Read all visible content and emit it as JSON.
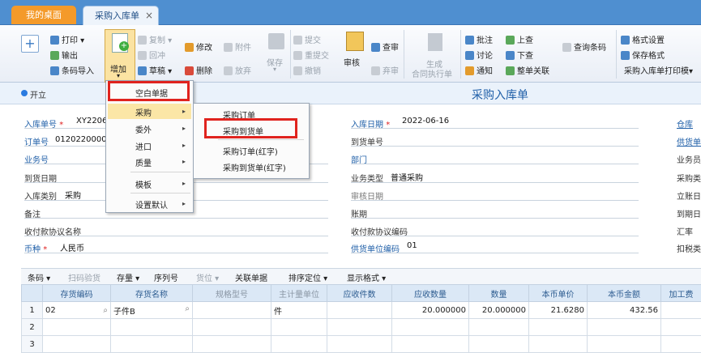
{
  "tabs": {
    "desktop": "我的桌面",
    "active": "采购入库单",
    "close": "×"
  },
  "ribbon": {
    "add": "增加",
    "print": "打印",
    "export": "输出",
    "barcode_import": "条码导入",
    "copy": "复制",
    "write_back": "回冲",
    "draft": "草稿",
    "modify": "修改",
    "delete": "删除",
    "attach": "附件",
    "abandon": "放弃",
    "save": "保存",
    "submit": "提交",
    "resubmit": "重提交",
    "withdraw": "撤销",
    "audit": "审核",
    "lookup": "查审",
    "discard": "弃审",
    "generate_1": "生成",
    "generate_2": "合同执行单",
    "annotate": "批注",
    "discuss": "讨论",
    "notify": "通知",
    "prev": "上查",
    "next": "下查",
    "whole_link": "整单关联",
    "query_barcode": "查询条码",
    "format_settings": "格式设置",
    "save_format": "保存格式",
    "print_template": "采购入库单打印模▾"
  },
  "status": {
    "open": "开立",
    "title": "采购入库单"
  },
  "form": {
    "inbound_no_label": "入库单号",
    "inbound_no": "XY22060",
    "order_no_label": "订单号",
    "order_no": "012022000001",
    "biz_no_label": "业务号",
    "arrival_date_label": "到货日期",
    "inbound_type_label": "入库类别",
    "inbound_type": "采购",
    "remark_label": "备注",
    "pay_agreement_label": "收付款协议名称",
    "currency_label": "币种",
    "currency": "人民币",
    "inbound_date_label": "入库日期",
    "inbound_date": "2022-06-16",
    "arrival_no_label": "到货单号",
    "dept_label": "部门",
    "biz_type_label": "业务类型",
    "biz_type": "普通采购",
    "audit_date_label": "审核日期",
    "account_period_label": "账期",
    "pay_agreement_code_label": "收付款协议编码",
    "supplier_code_label": "供货单位编码",
    "supplier_code": "01",
    "warehouse_label": "仓库",
    "supplier_label": "供货单",
    "biz_staff_label": "业务员",
    "purchase_type_label": "采购类",
    "account_date_label": "立账日",
    "due_date_label": "到期日",
    "rate_label": "汇率",
    "deduct_label": "扣税类"
  },
  "grid_toolbar": {
    "barcode": "条码",
    "scan_check": "扫码验货",
    "stock": "存量",
    "serial": "序列号",
    "location": "货位",
    "link_doc": "关联单据",
    "sort_pos": "排序定位",
    "display_fmt": "显示格式"
  },
  "grid": {
    "headers": [
      "",
      "存货编码",
      "存货名称",
      "规格型号",
      "主计量单位",
      "应收件数",
      "应收数量",
      "数量",
      "本币单价",
      "本币金额",
      "加工费"
    ],
    "rows": [
      {
        "n": "1",
        "code": "02",
        "name": "子件B",
        "spec": "",
        "unit": "件",
        "pieces": "",
        "due_qty": "20.000000",
        "qty": "20.000000",
        "price": "21.6280",
        "amount": "432.56",
        "fee": ""
      },
      {
        "n": "2",
        "code": "",
        "name": "",
        "spec": "",
        "unit": "",
        "pieces": "",
        "due_qty": "",
        "qty": "",
        "price": "",
        "amount": "",
        "fee": ""
      },
      {
        "n": "3",
        "code": "",
        "name": "",
        "spec": "",
        "unit": "",
        "pieces": "",
        "due_qty": "",
        "qty": "",
        "price": "",
        "amount": "",
        "fee": ""
      }
    ]
  },
  "menu1": {
    "blank": "空白单据",
    "purchase": "采购",
    "outsource": "委外",
    "import": "进口",
    "quality": "质量",
    "template": "模板",
    "default_settings": "设置默认"
  },
  "menu2": {
    "po": "采购订单",
    "arrival": "采购到货单",
    "po_red": "采购订单(红字)",
    "arrival_red": "采购到货单(红字)"
  },
  "colors": {
    "tab_bar": "#4f8fd0",
    "desk_tab": "#f49a2a",
    "highlight": "#e0231e",
    "menu_hover": "#fbe6a6"
  }
}
